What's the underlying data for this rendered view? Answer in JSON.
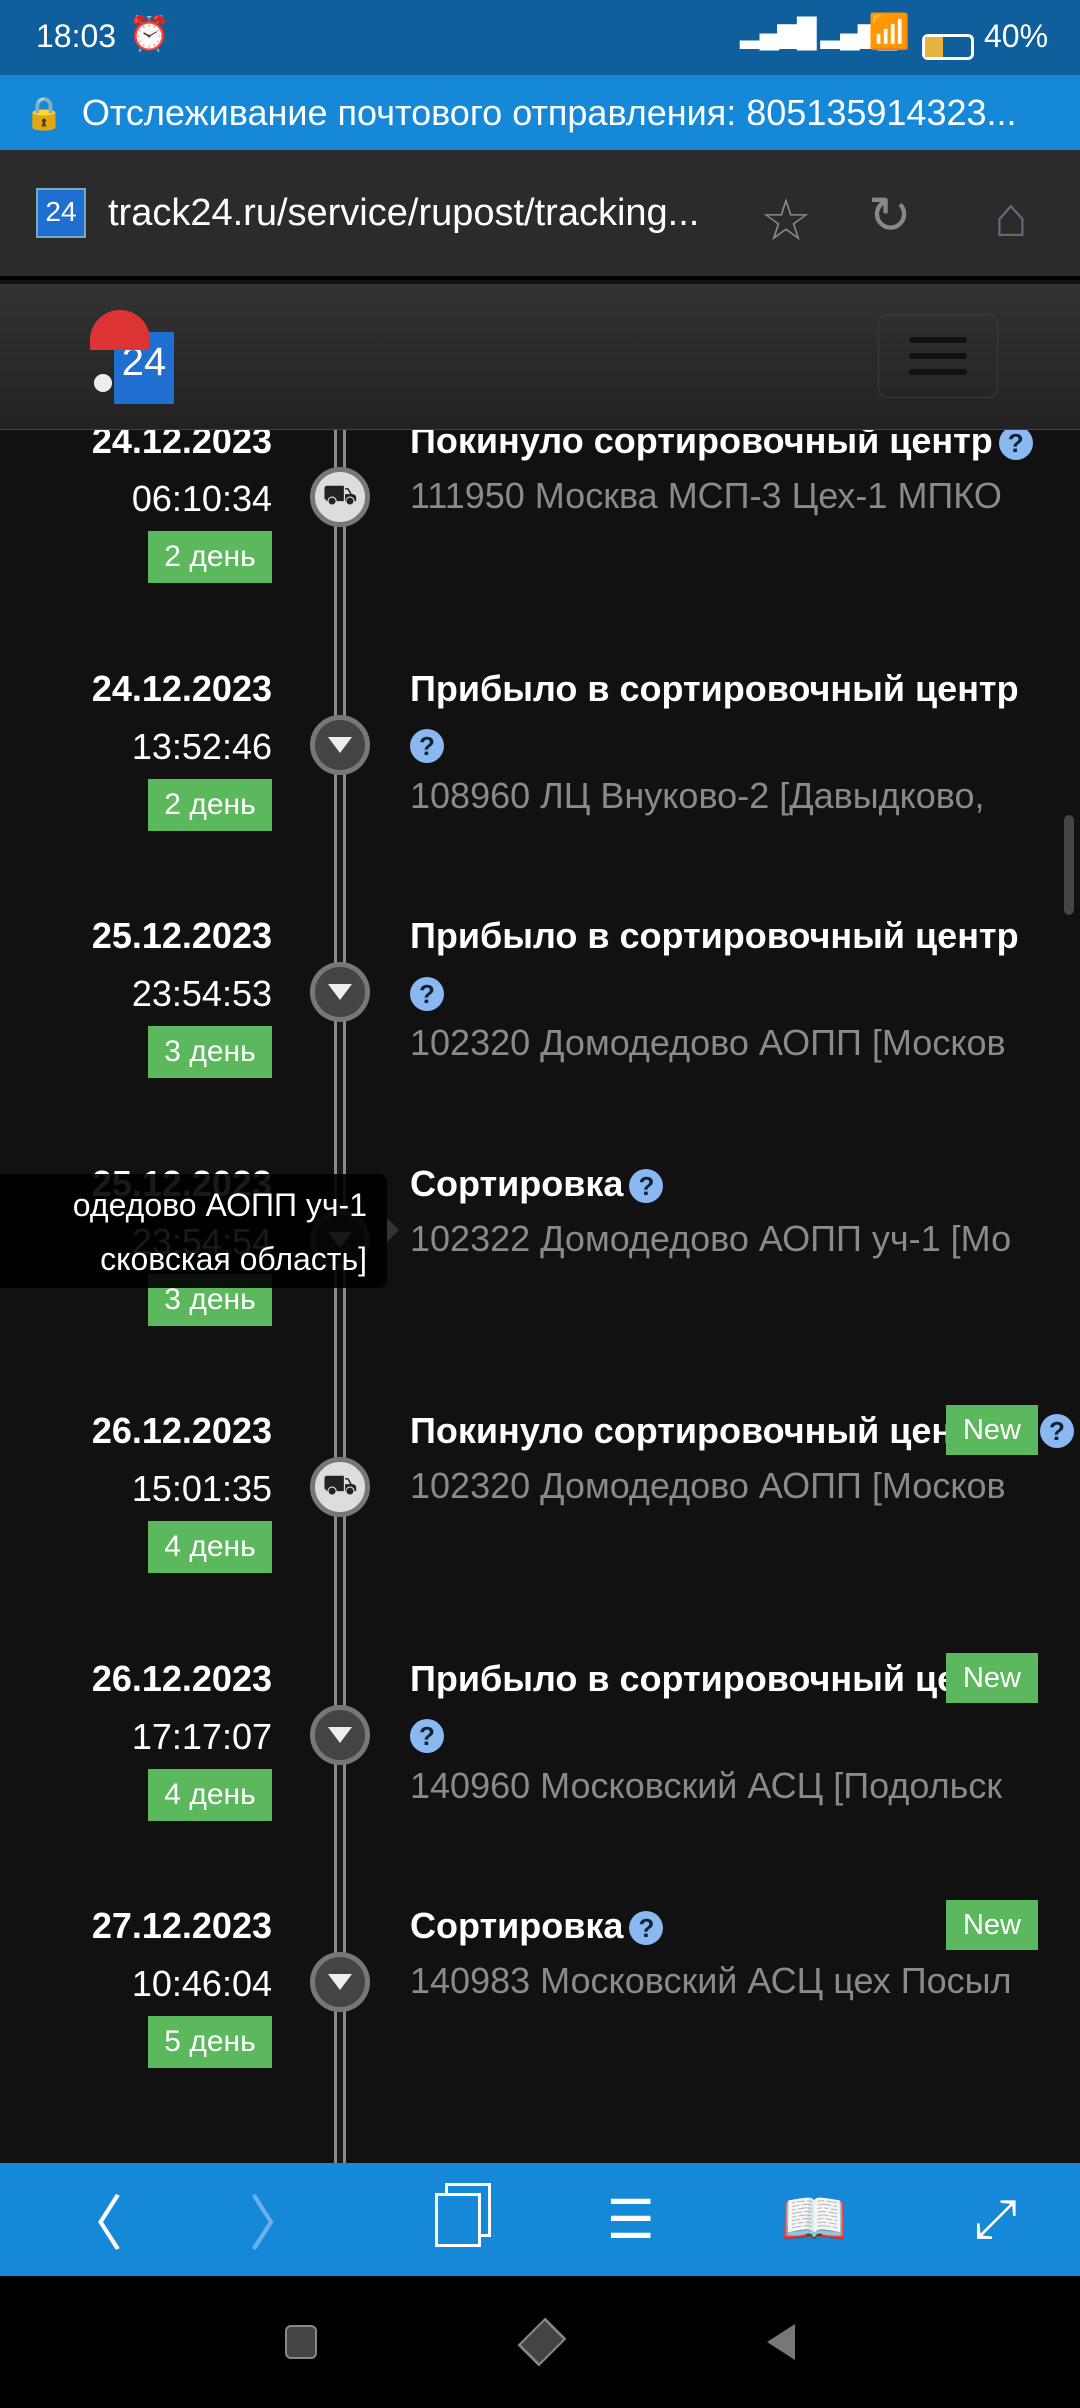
{
  "status": {
    "time": "18:03",
    "battery": "40%",
    "battery_level": 40
  },
  "titlebar": {
    "title": "Отслеживание почтового отправления: 805135914323..."
  },
  "urlbar": {
    "url": "track24.ru/service/rupost/tracking..."
  },
  "site": {
    "logo_text": "24"
  },
  "events": [
    {
      "date": "24.12.2023",
      "time": "06:10:34",
      "day": "2 день",
      "title": "Покинуло сортировочный центр",
      "location": "111950 Москва МСП-3 Цех-1 МПКО",
      "icon": "truck",
      "new": false,
      "help_wrapped": false
    },
    {
      "date": "24.12.2023",
      "time": "13:52:46",
      "day": "2 день",
      "title": "Прибыло в сортировочный центр",
      "location": "108960 ЛЦ Внуково-2 [Давыдково,",
      "icon": "arrow-down",
      "new": false,
      "help_wrapped": true
    },
    {
      "date": "25.12.2023",
      "time": "23:54:53",
      "day": "3 день",
      "title": "Прибыло в сортировочный центр",
      "location": "102320 Домодедово АОПП [Москов",
      "icon": "arrow-down",
      "new": false,
      "help_wrapped": true
    },
    {
      "date": "25.12.2023",
      "time": "23:54:54",
      "day": "3 день",
      "title": "Сортировка",
      "location": "102322 Домодедово АОПП уч-1 [Мо",
      "icon": "arrow-down",
      "new": false,
      "help_wrapped": false
    },
    {
      "date": "26.12.2023",
      "time": "15:01:35",
      "day": "4 день",
      "title": "Покинуло сортировочный центр",
      "location": "102320 Домодедово АОПП [Москов",
      "icon": "truck",
      "new": true,
      "help_wrapped": false
    },
    {
      "date": "26.12.2023",
      "time": "17:17:07",
      "day": "4 день",
      "title": "Прибыло в сортировочный центр",
      "location": "140960 Московский АСЦ [Подольск",
      "icon": "arrow-down",
      "new": true,
      "help_wrapped": true
    },
    {
      "date": "27.12.2023",
      "time": "10:46:04",
      "day": "5 день",
      "title": "Сортировка",
      "location": "140983 Московский АСЦ цех Посыл",
      "icon": "arrow-down",
      "new": true,
      "help_wrapped": false
    }
  ],
  "labels": {
    "new": "New",
    "help": "?"
  },
  "tooltip": {
    "line1": "одедово АОПП уч-1",
    "line2": "сковская область]"
  }
}
